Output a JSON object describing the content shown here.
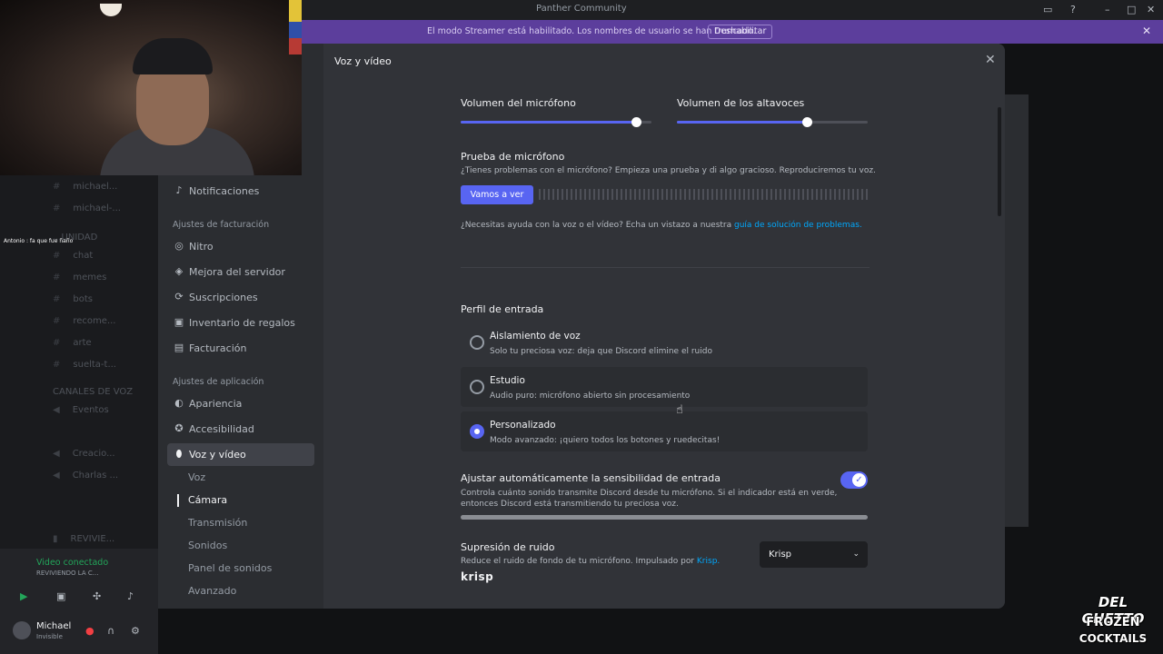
{
  "window": {
    "title": "Panther Community"
  },
  "streamer_banner": {
    "message": "El modo Streamer está habilitado. Los nombres de usuario se han truncado.",
    "disable_label": "Deshabilitar"
  },
  "background_channels": {
    "items": [
      "michael...",
      "michael-...",
      "chat",
      "memes",
      "bots",
      "recome...",
      "arte",
      "suelta-t...",
      "Eventos",
      "Creacio...",
      "Charlas ...",
      "REVIVIE..."
    ],
    "section_community": "...UNIDAD",
    "section_voice": "CANALES DE VOZ",
    "chat_overlay": "Antonio : fa que fue ñaño",
    "voice_status": "Video conectado",
    "voice_channel": "REVIVIENDO LA C...",
    "user_name": "Michael",
    "user_status": "Invisible"
  },
  "sidebar": {
    "top_item": "Notificaciones",
    "billing_header": "Ajustes de facturación",
    "billing_items": [
      "Nitro",
      "Mejora del servidor",
      "Suscripciones",
      "Inventario de regalos",
      "Facturación"
    ],
    "app_header": "Ajustes de aplicación",
    "app_items": [
      "Apariencia",
      "Accesibilidad",
      "Voz y vídeo"
    ],
    "sub_items": [
      "Voz",
      "Cámara",
      "Transmisión",
      "Sonidos",
      "Panel de sonidos",
      "Avanzado"
    ]
  },
  "content": {
    "page_title": "Voz y vídeo",
    "mic_volume_label": "Volumen del micrófono",
    "mic_volume": 0.92,
    "speaker_volume_label": "Volumen de los altavoces",
    "speaker_volume": 0.68,
    "mic_test_title": "Prueba de micrófono",
    "mic_test_desc": "¿Tienes problemas con el micrófono? Empieza una prueba y di algo gracioso. Reproduciremos tu voz.",
    "mic_test_button": "Vamos a ver",
    "help_text": "¿Necesitas ayuda con la voz o el vídeo? Echa un vistazo a nuestra",
    "help_link": "guía de solución de problemas.",
    "input_profile_title": "Perfil de entrada",
    "profiles": [
      {
        "title": "Aislamiento de voz",
        "desc": "Solo tu preciosa voz: deja que Discord elimine el ruido",
        "selected": false
      },
      {
        "title": "Estudio",
        "desc": "Audio puro: micrófono abierto sin procesamiento",
        "selected": false
      },
      {
        "title": "Personalizado",
        "desc": "Modo avanzado: ¡quiero todos los botones y ruedecitas!",
        "selected": true
      }
    ],
    "auto_sens_title": "Ajustar automáticamente la sensibilidad de entrada",
    "auto_sens_desc_1": "Controla cuánto sonido transmite Discord desde tu micrófono. Si el indicador está en verde,",
    "auto_sens_desc_2": "entonces Discord está transmitiendo tu preciosa voz.",
    "auto_sens_enabled": true,
    "noise_title": "Supresión de ruido",
    "noise_desc": "Reduce el ruido de fondo de tu micrófono. Impulsado por",
    "noise_desc_link": "Krisp.",
    "noise_select": "Krisp",
    "krisp_logo": "krisp"
  },
  "overlay_logo": {
    "line1": "DEL GHETTO",
    "line2": "FROZEN",
    "line3": "COCKTAILS"
  },
  "colors": {
    "accent": "#5865f2",
    "banner": "#5c3e9c",
    "link": "#00a8fc"
  }
}
